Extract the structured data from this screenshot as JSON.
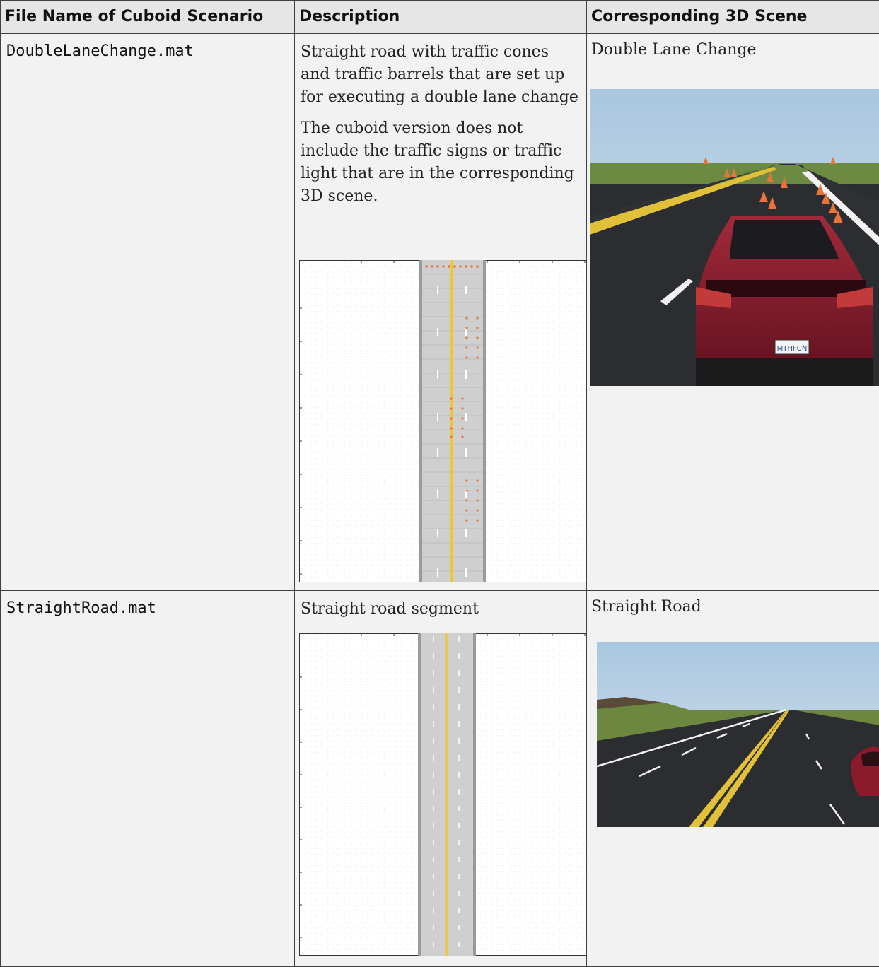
{
  "headers": {
    "col1": "File Name of Cuboid Scenario",
    "col2": "Description",
    "col3": "Corresponding 3D Scene"
  },
  "rows": [
    {
      "file": "DoubleLaneChange.mat",
      "description": [
        "Straight road with traffic cones and traffic barrels that are set up for executing a double lane change",
        "The cuboid version does not include the traffic signs or traffic light that are in the corresponding 3D scene."
      ],
      "scene_label": "Double Lane Change",
      "plate_text": "MTHFUN"
    },
    {
      "file": "StraightRoad.mat",
      "description": [
        "Straight road segment"
      ],
      "scene_label": "Straight Road"
    }
  ],
  "colors": {
    "lane_center": "#f5c518",
    "cone": "#e8743b",
    "road": "#c8c8c8",
    "car": "#8b1a2b",
    "grass": "#6f8a3f",
    "sky": "#cfe0ee"
  }
}
